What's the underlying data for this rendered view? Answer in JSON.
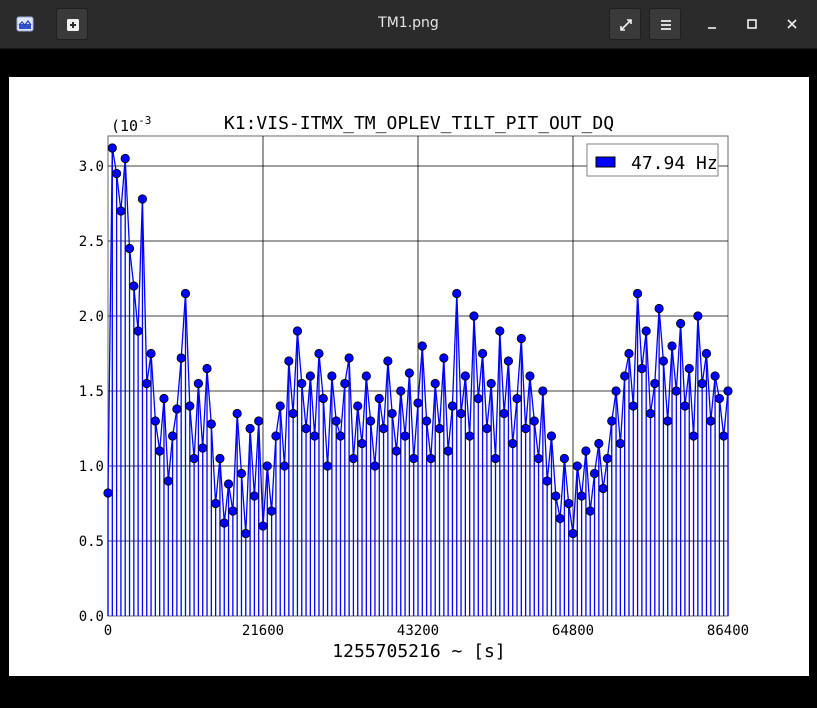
{
  "window": {
    "title": "TM1.png",
    "icons": {
      "app": "image-viewer-app-icon",
      "new": "plus-square-icon",
      "fullscreen": "expand-arrows-icon",
      "menu": "hamburger-menu-icon",
      "minimize": "minimize-icon",
      "maximize": "maximize-icon",
      "close": "close-icon"
    }
  },
  "chart_data": {
    "type": "scatter",
    "title": "K1:VIS-ITMX_TM_OPLEV_TILT_PIT_OUT_DQ",
    "xlabel": "1255705216 ~ [s]",
    "ylabel": "",
    "y_exponent": "(10",
    "y_exponent_power": "-3",
    "xlim": [
      0,
      86400
    ],
    "ylim": [
      0,
      3.2
    ],
    "xticks": [
      0,
      21600,
      43200,
      64800,
      86400
    ],
    "yticks": [
      0.0,
      0.5,
      1.0,
      1.5,
      2.0,
      2.5,
      3.0
    ],
    "xtick_labels": [
      "0",
      "21600",
      "43200",
      "64800",
      "86400"
    ],
    "ytick_labels": [
      "0.0",
      "0.5",
      "1.0",
      "1.5",
      "2.0",
      "2.5",
      "3.0"
    ],
    "grid": true,
    "legend_position": "top-right",
    "series": [
      {
        "name": "47.94 Hz",
        "color": "#0000ff",
        "marker_edge": "#000000",
        "line": "stems-and-connect",
        "x": [
          0,
          600,
          1200,
          1800,
          2400,
          3000,
          3600,
          4200,
          4800,
          5400,
          6000,
          6600,
          7200,
          7800,
          8400,
          9000,
          9600,
          10200,
          10800,
          11400,
          12000,
          12600,
          13200,
          13800,
          14400,
          15000,
          15600,
          16200,
          16800,
          17400,
          18000,
          18600,
          19200,
          19800,
          20400,
          21000,
          21600,
          22200,
          22800,
          23400,
          24000,
          24600,
          25200,
          25800,
          26400,
          27000,
          27600,
          28200,
          28800,
          29400,
          30000,
          30600,
          31200,
          31800,
          32400,
          33000,
          33600,
          34200,
          34800,
          35400,
          36000,
          36600,
          37200,
          37800,
          38400,
          39000,
          39600,
          40200,
          40800,
          41400,
          42000,
          42600,
          43200,
          43800,
          44400,
          45000,
          45600,
          46200,
          46800,
          47400,
          48000,
          48600,
          49200,
          49800,
          50400,
          51000,
          51600,
          52200,
          52800,
          53400,
          54000,
          54600,
          55200,
          55800,
          56400,
          57000,
          57600,
          58200,
          58800,
          59400,
          60000,
          60600,
          61200,
          61800,
          62400,
          63000,
          63600,
          64200,
          64800,
          65400,
          66000,
          66600,
          67200,
          67800,
          68400,
          69000,
          69600,
          70200,
          70800,
          71400,
          72000,
          72600,
          73200,
          73800,
          74400,
          75000,
          75600,
          76200,
          76800,
          77400,
          78000,
          78600,
          79200,
          79800,
          80400,
          81000,
          81600,
          82200,
          82800,
          83400,
          84000,
          84600,
          85200,
          85800,
          86400
        ],
        "values": [
          0.82,
          3.12,
          2.95,
          2.7,
          3.05,
          2.45,
          2.2,
          1.9,
          2.78,
          1.55,
          1.75,
          1.3,
          1.1,
          1.45,
          0.9,
          1.2,
          1.38,
          1.72,
          2.15,
          1.4,
          1.05,
          1.55,
          1.12,
          1.65,
          1.28,
          0.75,
          1.05,
          0.62,
          0.88,
          0.7,
          1.35,
          0.95,
          0.55,
          1.25,
          0.8,
          1.3,
          0.6,
          1.0,
          0.7,
          1.2,
          1.4,
          1.0,
          1.7,
          1.35,
          1.9,
          1.55,
          1.25,
          1.6,
          1.2,
          1.75,
          1.45,
          1.0,
          1.6,
          1.3,
          1.2,
          1.55,
          1.72,
          1.05,
          1.4,
          1.15,
          1.6,
          1.3,
          1.0,
          1.45,
          1.25,
          1.7,
          1.35,
          1.1,
          1.5,
          1.2,
          1.62,
          1.05,
          1.42,
          1.8,
          1.3,
          1.05,
          1.55,
          1.25,
          1.72,
          1.1,
          1.4,
          2.15,
          1.35,
          1.6,
          1.2,
          2.0,
          1.45,
          1.75,
          1.25,
          1.55,
          1.05,
          1.9,
          1.35,
          1.7,
          1.15,
          1.45,
          1.85,
          1.25,
          1.6,
          1.3,
          1.05,
          1.5,
          0.9,
          1.2,
          0.8,
          0.65,
          1.05,
          0.75,
          0.55,
          1.0,
          0.8,
          1.1,
          0.7,
          0.95,
          1.15,
          0.85,
          1.05,
          1.3,
          1.5,
          1.15,
          1.6,
          1.75,
          1.4,
          2.15,
          1.65,
          1.9,
          1.35,
          1.55,
          2.05,
          1.7,
          1.3,
          1.8,
          1.5,
          1.95,
          1.4,
          1.65,
          1.2,
          2.0,
          1.55,
          1.75,
          1.3,
          1.6,
          1.45,
          1.2,
          1.5
        ]
      }
    ]
  }
}
